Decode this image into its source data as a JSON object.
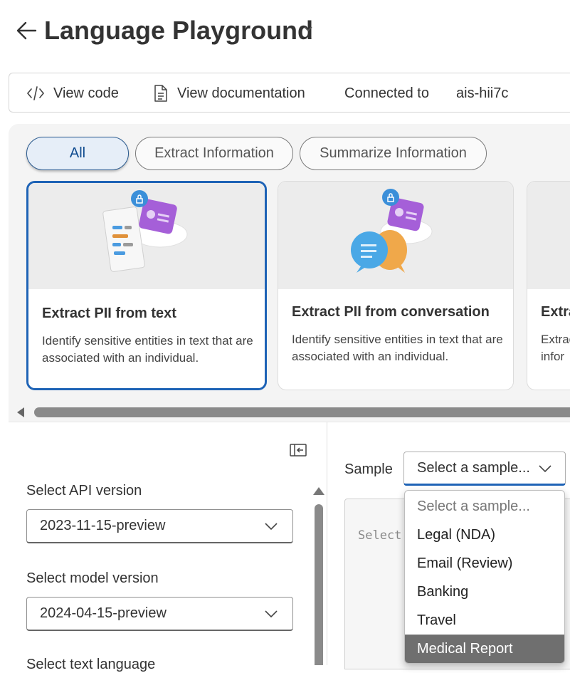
{
  "header": {
    "title": "Language Playground"
  },
  "toolbar": {
    "view_code": "View code",
    "view_documentation": "View documentation",
    "connected_label": "Connected to",
    "connected_value": "ais-hii7c"
  },
  "filters": [
    "All",
    "Extract Information",
    "Summarize Information"
  ],
  "active_filter": "All",
  "cards": [
    {
      "title": "Extract PII from text",
      "description": "Identify sensitive entities in text that are associated with an individual."
    },
    {
      "title": "Extract PII from conversation",
      "description": "Identify sensitive entities in text that are associated with an individual."
    },
    {
      "title": "Extra",
      "description": "Extrac infor"
    }
  ],
  "settings": {
    "api_version_label": "Select API version",
    "api_version_value": "2023-11-15-preview",
    "model_version_label": "Select model version",
    "model_version_value": "2024-04-15-preview",
    "text_language_label": "Select text language"
  },
  "sample": {
    "label": "Sample",
    "selected": "Select a sample...",
    "text_placeholder": "Select",
    "options": [
      "Select a sample...",
      "Legal (NDA)",
      "Email (Review)",
      "Banking",
      "Travel",
      "Medical Report"
    ],
    "highlighted": "Medical Report"
  },
  "icons": [
    "back-arrow-icon",
    "chevron-down-icon",
    "code-icon",
    "document-icon",
    "collapse-panel-icon"
  ],
  "colors": {
    "accent": "#1e63b6",
    "active_pill_bg": "#e6eef8",
    "highlight_option": "#6f6f6f"
  }
}
